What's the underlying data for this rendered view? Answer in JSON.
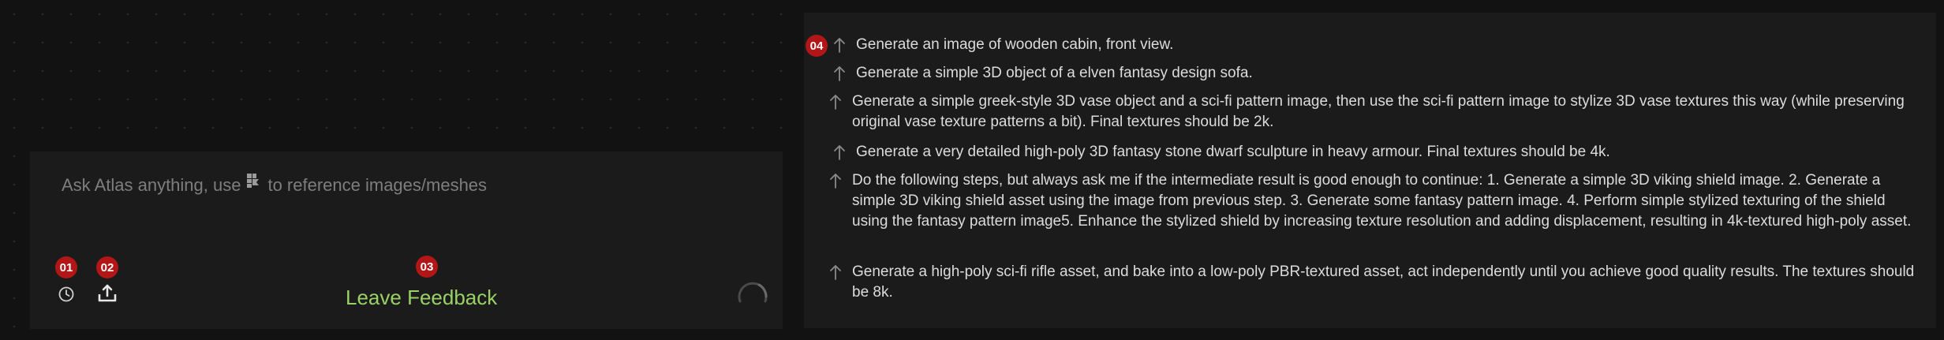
{
  "composer": {
    "prompt_before": "Ask Atlas anything, use",
    "prompt_after": "to reference images/meshes",
    "reference_icon": "image-reference-icon",
    "badges": [
      "01",
      "02",
      "03"
    ],
    "tools": [
      {
        "name": "history-icon",
        "badge": "01"
      },
      {
        "name": "upload-icon",
        "badge": "02"
      }
    ],
    "feedback_label": "Leave Feedback",
    "feedback_badge": "03",
    "spinner_icon": "loading-spinner-icon"
  },
  "suggestions": {
    "badge": "04",
    "items": [
      {
        "text": "Generate an image of wooden cabin, front view."
      },
      {
        "text": "Generate a simple 3D object of a elven fantasy design sofa."
      },
      {
        "text": "Generate a simple greek-style 3D vase object and a sci-fi pattern image, then use the sci-fi pattern image to stylize 3D vase textures this way (while preserving original vase texture patterns a bit). Final textures should be 2k."
      },
      {
        "text": "Generate a very detailed high-poly 3D fantasy stone dwarf sculpture in heavy armour. Final textures should be 4k."
      },
      {
        "text": "Do the following steps, but always ask me if the intermediate result is good enough to continue: 1. Generate a simple 3D viking shield image. 2. Generate a simple 3D viking shield asset using the image from previous step. 3. Generate some fantasy pattern image. 4. Perform simple stylized texturing of the shield using the fantasy pattern image5. Enhance the stylized shield by increasing texture resolution and adding displacement, resulting in 4k-textured high-poly asset."
      },
      {
        "text": "Generate a high-poly sci-fi rifle asset, and bake into a low-poly PBR-textured asset, act independently until you achieve good quality results. The textures should be 8k."
      }
    ],
    "arrow_icon": "arrow-up-icon"
  },
  "colors": {
    "background": "#121212",
    "panel": "#1b1b1b",
    "badge": "#b21616",
    "feedback": "#9ad166",
    "text": "#dcdcdc",
    "muted": "#7e7e7e"
  }
}
